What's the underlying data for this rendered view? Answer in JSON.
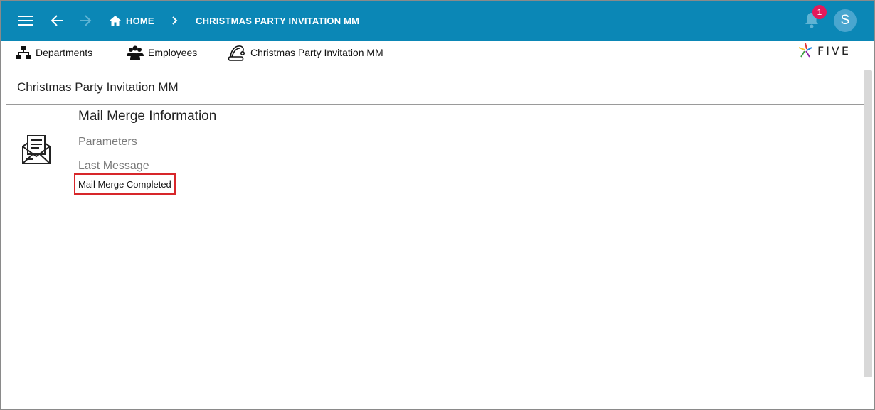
{
  "topbar": {
    "home_label": "HOME",
    "page_label": "CHRISTMAS PARTY INVITATION MM",
    "notification_count": "1",
    "avatar_initial": "S",
    "colors": {
      "bar": "#0b87b6",
      "badge": "#e5195b",
      "avatar": "#4aa6cf"
    }
  },
  "tabs": [
    {
      "label": "Departments",
      "icon": "sitemap-icon"
    },
    {
      "label": "Employees",
      "icon": "users-icon"
    },
    {
      "label": "Christmas Party Invitation MM",
      "icon": "santa-hat-icon"
    }
  ],
  "brand": {
    "logo_text": "FIVE"
  },
  "main": {
    "page_title": "Christmas Party Invitation MM",
    "section_title": "Mail Merge Information",
    "parameters_label": "Parameters",
    "last_message_label": "Last Message",
    "last_message_value": "Mail Merge Completed",
    "highlight_color": "#d7262a"
  }
}
